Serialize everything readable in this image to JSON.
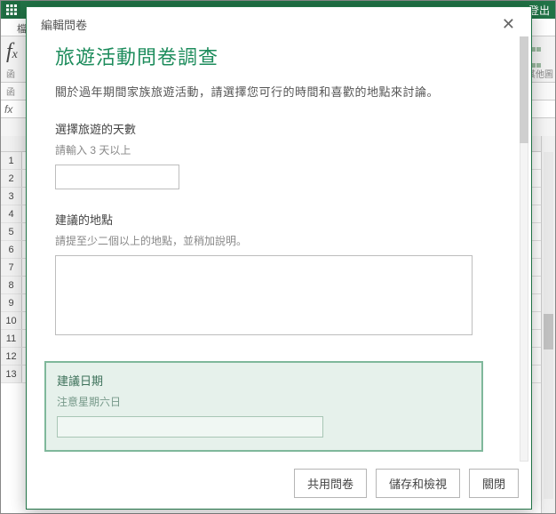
{
  "app": {
    "logout": "登出",
    "ribbon_group_fn": "函",
    "ribbon_group_other": "其他圖",
    "namebox": "函",
    "row_numbers": [
      "1",
      "2",
      "3",
      "4",
      "5",
      "6",
      "7",
      "8",
      "9",
      "10",
      "11",
      "12",
      "13"
    ]
  },
  "dialog": {
    "header_title": "編輯問卷",
    "survey_title": "旅遊活動問卷調查",
    "survey_description": "關於過年期間家族旅遊活動，請選擇您可行的時間和喜歡的地點來討論。",
    "q1": {
      "label": "選擇旅遊的天數",
      "hint": "請輸入 3 天以上",
      "value": ""
    },
    "q2": {
      "label": "建議的地點",
      "hint": "請提至少二個以上的地點，並稍加說明。",
      "value": ""
    },
    "q3": {
      "label": "建議日期",
      "hint": "注意星期六日",
      "value": ""
    },
    "buttons": {
      "share": "共用問卷",
      "save_view": "儲存和檢視",
      "close": "關閉"
    }
  }
}
